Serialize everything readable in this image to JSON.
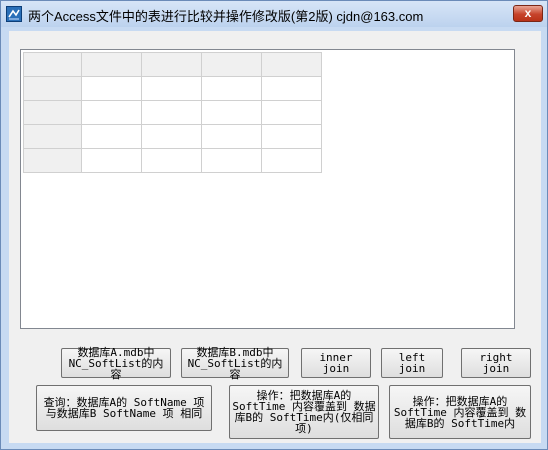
{
  "window": {
    "title": "两个Access文件中的表进行比较并操作修改版(第2版)   cjdn@163.com",
    "close_glyph": "x"
  },
  "grid": {
    "rows": 5,
    "columns": 5
  },
  "buttons": {
    "load_a": "数据库A.mdb中\nNC_SoftList的内容",
    "load_b": "数据库B.mdb中\nNC_SoftList的内容",
    "inner_join": "inner join",
    "left_join": "left join",
    "right_join": "right join",
    "query_same": "查询：数据库A的 SoftName 项\n与数据库B SoftName 项 相同",
    "overwrite_b_same": "操作：把数据库A的\nSoftTime 内容覆盖到 数据\n库B的 SoftTime内(仅相同\n项)",
    "overwrite_b_all": "操作：把数据库A的\nSoftTime 内容覆盖到 数\n据库B的 SoftTime内"
  }
}
